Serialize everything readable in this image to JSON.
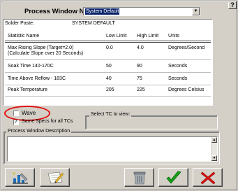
{
  "dialog": {
    "help_label": "?",
    "process_window_label": "Process Window Name:",
    "process_window_value": "System Default"
  },
  "list": {
    "solder_paste_label": "Solder Paste:",
    "solder_paste_value": "SYSTEM DEFAULT",
    "headers": [
      "Statistic Name",
      "Low Limit",
      "High Limit",
      "Units"
    ],
    "rows": [
      {
        "name": "Max Rising Slope (Target=2.0)",
        "name2": "(Calculate Slope over 20 Seconds)",
        "low": "0.0",
        "high": "4.0",
        "units": "Degrees/Second"
      },
      {
        "name": "Soak Time 140-170C",
        "low": "50",
        "high": "90",
        "units": "Seconds"
      },
      {
        "name": "Time Above Reflow - 183C",
        "low": "40",
        "high": "75",
        "units": "Seconds"
      },
      {
        "name": "Peak Temperature",
        "low": "205",
        "high": "225",
        "units": "Degrees Celsius"
      }
    ]
  },
  "options": {
    "wave_label": "Wave",
    "wave_checked": false,
    "same_specs_label": "Same Specs for all TCs",
    "same_specs_checked": true,
    "select_tc_label": "Select TC to view:"
  },
  "description": {
    "label": "Process Window Description",
    "value": ""
  },
  "toolbar": {
    "icons": [
      "chart-tool-icon",
      "edit-paper-icon",
      "trash-bin-icon",
      "ok-checkmark-icon",
      "cancel-x-icon"
    ],
    "ok_color": "#14a014",
    "cancel_color": "#e01010"
  }
}
